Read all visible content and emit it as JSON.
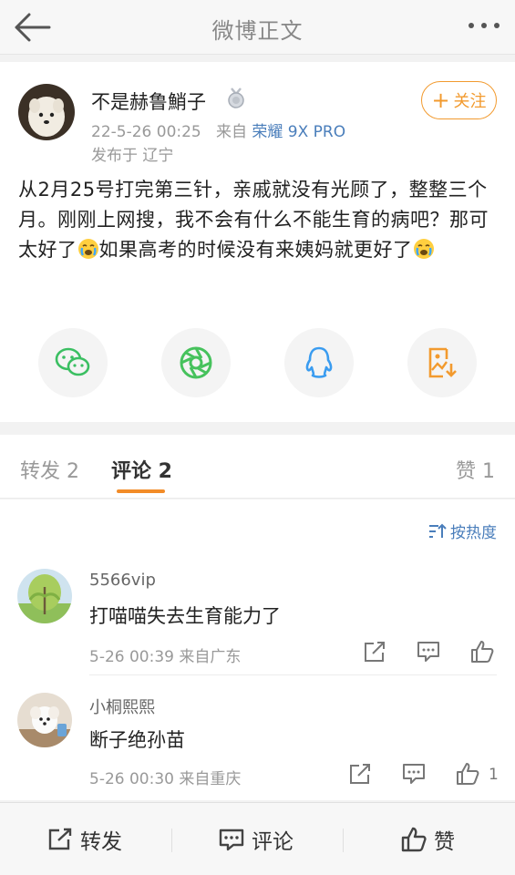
{
  "header": {
    "title": "微博正文"
  },
  "post": {
    "author": "不是赫鲁鮹子",
    "time": "22-5-26 00:25",
    "from_prefix": "来自",
    "source": "荣耀 9X PRO",
    "location": "发布于 辽宁",
    "follow_label": "关注",
    "text_1": "从2月25号打完第三针，亲戚就没有光顾了，整整三个月。刚刚上网搜，我不会有什么不能生育的病吧？那可太好了",
    "text_2": "如果高考的时候没有来姨妈就更好了"
  },
  "tabs": {
    "repost": "转发 2",
    "comment": "评论 2",
    "like": "赞 1"
  },
  "sort_label": "按热度",
  "comments": [
    {
      "name": "5566vip",
      "text": "打喵喵失去生育能力了",
      "meta": "5-26 00:39  来自广东",
      "likes": ""
    },
    {
      "name": "小桐熙熙",
      "text": "断子绝孙苗",
      "meta": "5-26 00:30  来自重庆",
      "likes": "1"
    }
  ],
  "bottom": {
    "repost": "转发",
    "comment": "评论",
    "like": "赞"
  },
  "colors": {
    "accent": "#f28c28",
    "link": "#4a7ebb",
    "follow": "#f29a2e"
  }
}
